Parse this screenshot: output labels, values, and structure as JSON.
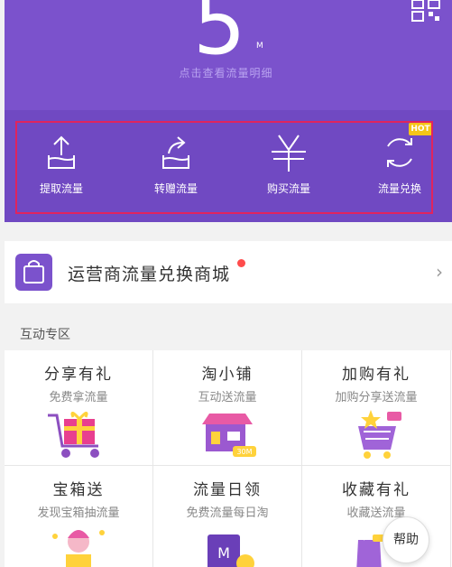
{
  "hero": {
    "balance_value": "5",
    "unit": "M",
    "detail_link": "点击查看流量明细"
  },
  "actions": [
    {
      "label": "提取流量",
      "icon": "upload-tray-icon"
    },
    {
      "label": "转赠流量",
      "icon": "share-forward-icon"
    },
    {
      "label": "购买流量",
      "icon": "yuan-icon"
    },
    {
      "label": "流量兑换",
      "icon": "refresh-icon"
    }
  ],
  "hot_badge": "HOT",
  "mall": {
    "title": "运营商流量兑换商城",
    "icon": "shopping-bag-icon"
  },
  "section": {
    "title": "互动专区"
  },
  "cards": [
    {
      "title": "分享有礼",
      "subtitle": "免费拿流量"
    },
    {
      "title": "淘小铺",
      "subtitle": "互动送流量"
    },
    {
      "title": "加购有礼",
      "subtitle": "加购分享送流量"
    },
    {
      "title": "宝箱送",
      "subtitle": "发现宝箱抽流量"
    },
    {
      "title": "流量日领",
      "subtitle": "免费流量每日淘"
    },
    {
      "title": "收藏有礼",
      "subtitle": "收藏送流量"
    }
  ],
  "card_art_badges": {
    "shop_tag": "30M",
    "wallet_letter": "M"
  },
  "help_button": "帮助",
  "colors": {
    "brand_purple": "#7b52cc",
    "highlight_red": "#e0245e",
    "hot_yellow": "#f5c518"
  }
}
